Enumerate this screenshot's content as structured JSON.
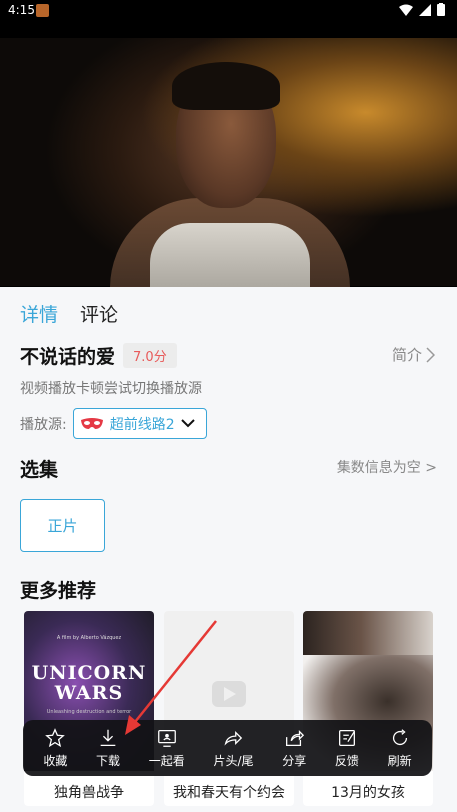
{
  "status": {
    "time": "4:15"
  },
  "tabs": [
    {
      "label": "详情",
      "active": true
    },
    {
      "label": "评论",
      "active": false
    }
  ],
  "movie": {
    "title": "不说话的爱",
    "score": "7.0分",
    "intro_label": "简介",
    "tip": "视频播放卡顿尝试切换播放源"
  },
  "source": {
    "label": "播放源:",
    "value": "超前线路2"
  },
  "episodes": {
    "title": "选集",
    "info": "集数信息为空 >",
    "items": [
      {
        "label": "正片"
      }
    ]
  },
  "recommend": {
    "title": "更多推荐",
    "items": [
      {
        "title": "独角兽战争",
        "poster_title": "UNICORN WARS",
        "poster_top": "A film by Alberto Vázquez",
        "poster_sub": "Unleashing destruction and terror"
      },
      {
        "title": "我和春天有个约会"
      },
      {
        "title": "13月的女孩"
      }
    ]
  },
  "actions": [
    {
      "label": "收藏",
      "icon": "star-icon"
    },
    {
      "label": "下载",
      "icon": "download-icon"
    },
    {
      "label": "一起看",
      "icon": "watch-together-icon"
    },
    {
      "label": "片头/尾",
      "icon": "skip-intro-icon"
    },
    {
      "label": "分享",
      "icon": "share-icon"
    },
    {
      "label": "反馈",
      "icon": "feedback-icon"
    },
    {
      "label": "刷新",
      "icon": "refresh-icon"
    }
  ],
  "colors": {
    "accent": "#3aa6d8",
    "score": "#e85a5a",
    "arrow": "#e53935"
  }
}
